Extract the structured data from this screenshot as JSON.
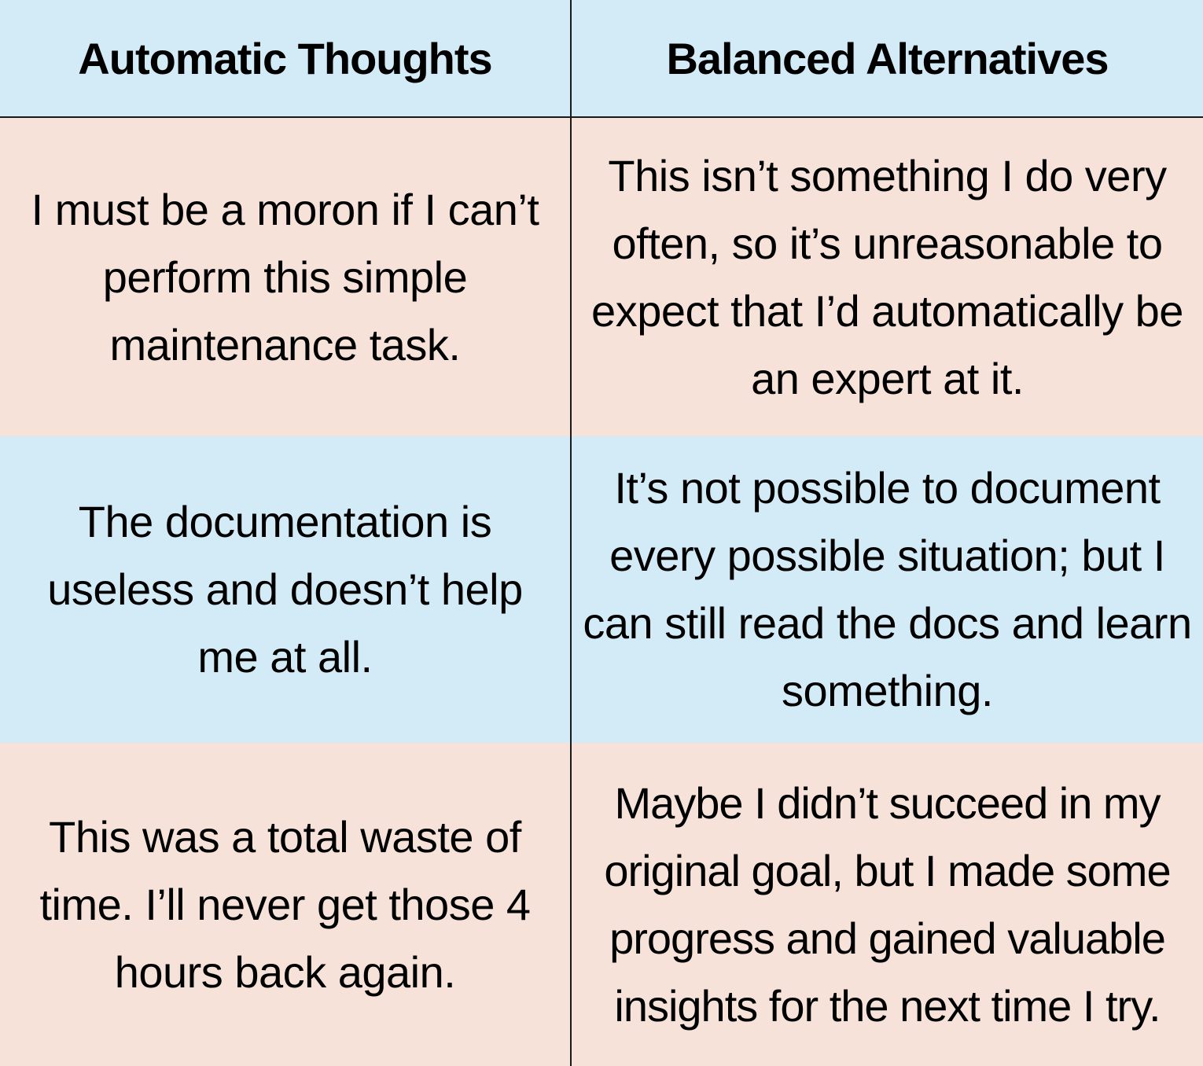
{
  "table": {
    "headers": {
      "left": "Automatic Thoughts",
      "right": "Balanced Alternatives"
    },
    "rows": [
      {
        "thought": "I must be a moron if I can’t perform this simple maintenance task.",
        "alternative": "This isn’t something I do very often, so it’s unreasonable to expect that I’d automatically be an expert at it.",
        "color": "#f6e2d9"
      },
      {
        "thought": "The documentation is useless and doesn’t help me at all.",
        "alternative": "It’s not possible to document every possible situation; but I can still read the docs and learn something.",
        "color": "#d2ebf7"
      },
      {
        "thought": "This was a total waste of time. I’ll never get those 4 hours back again.",
        "alternative": "Maybe I didn’t succeed in my original goal, but I made some progress and gained valuable insights for the next time I try.",
        "color": "#f6e2d9"
      }
    ],
    "header_color": "#d2ebf7",
    "border_color": "#1a1a1a"
  }
}
